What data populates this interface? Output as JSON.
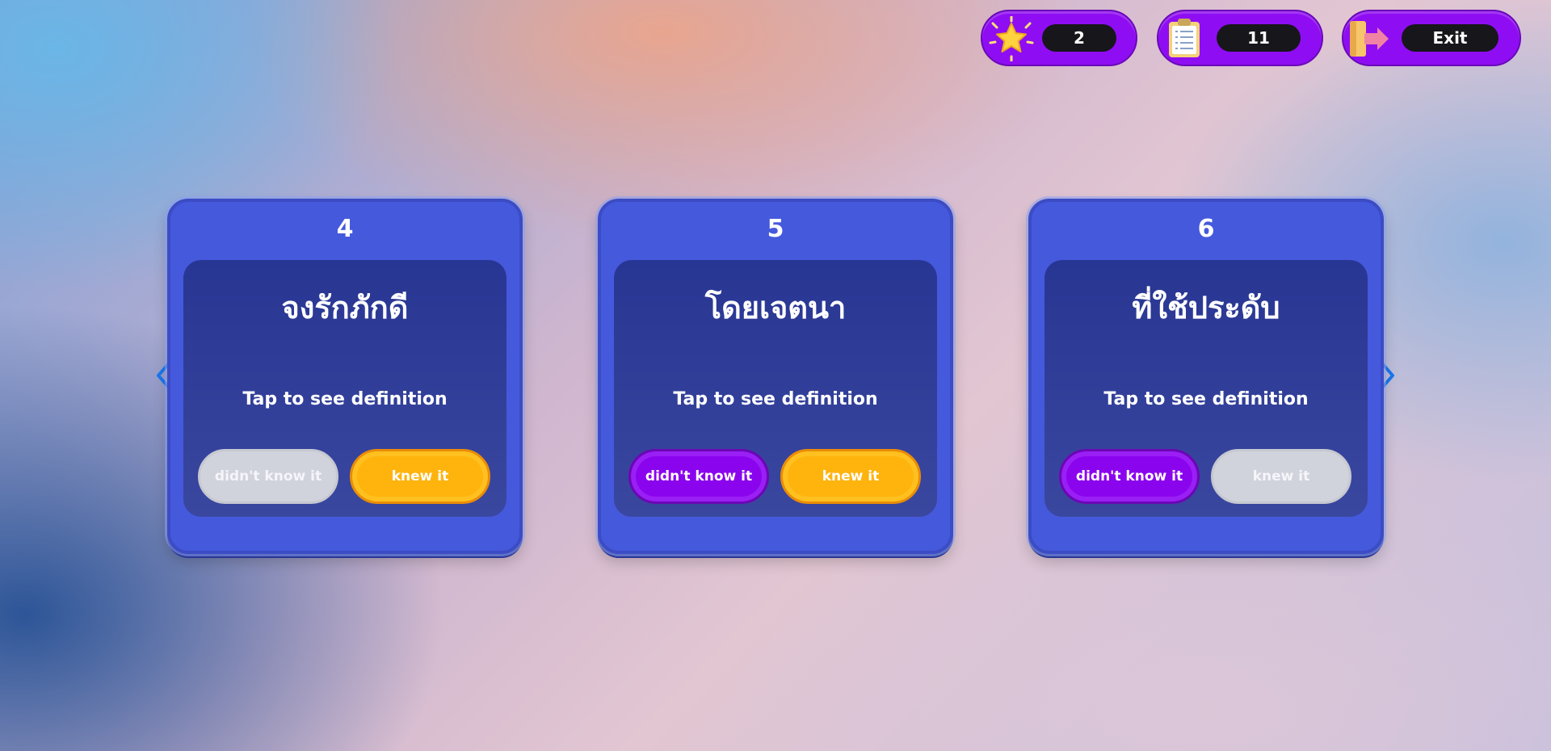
{
  "hud": {
    "stars": {
      "icon": "star-icon",
      "value": "2"
    },
    "cards": {
      "icon": "clipboard-icon",
      "value": "11"
    },
    "exit": {
      "icon": "exit-door-icon",
      "label": "Exit"
    }
  },
  "cards": [
    {
      "number": "4",
      "word": "จงรักภักดี",
      "hint": "Tap to see definition",
      "left_button": {
        "label": "didn't know it",
        "state": "disabled"
      },
      "right_button": {
        "label": "knew it",
        "state": "active"
      }
    },
    {
      "number": "5",
      "word": "โดยเจตนา",
      "hint": "Tap to see definition",
      "left_button": {
        "label": "didn't know it",
        "state": "active"
      },
      "right_button": {
        "label": "knew it",
        "state": "active"
      }
    },
    {
      "number": "6",
      "word": "ที่ใช้ประดับ",
      "hint": "Tap to see definition",
      "left_button": {
        "label": "didn't know it",
        "state": "active"
      },
      "right_button": {
        "label": "knew it",
        "state": "disabled"
      }
    }
  ],
  "navigation": {
    "prev_icon": "chevron-left-icon",
    "next_icon": "chevron-right-icon"
  },
  "colors": {
    "hud_purple": "#8f0df2",
    "card_blue": "#4559dd",
    "card_inner": "#283693",
    "button_purple": "#8b04ee",
    "button_orange": "#ffb30d",
    "button_disabled": "#d1d3dc",
    "arrow_blue": "#1877f2"
  }
}
